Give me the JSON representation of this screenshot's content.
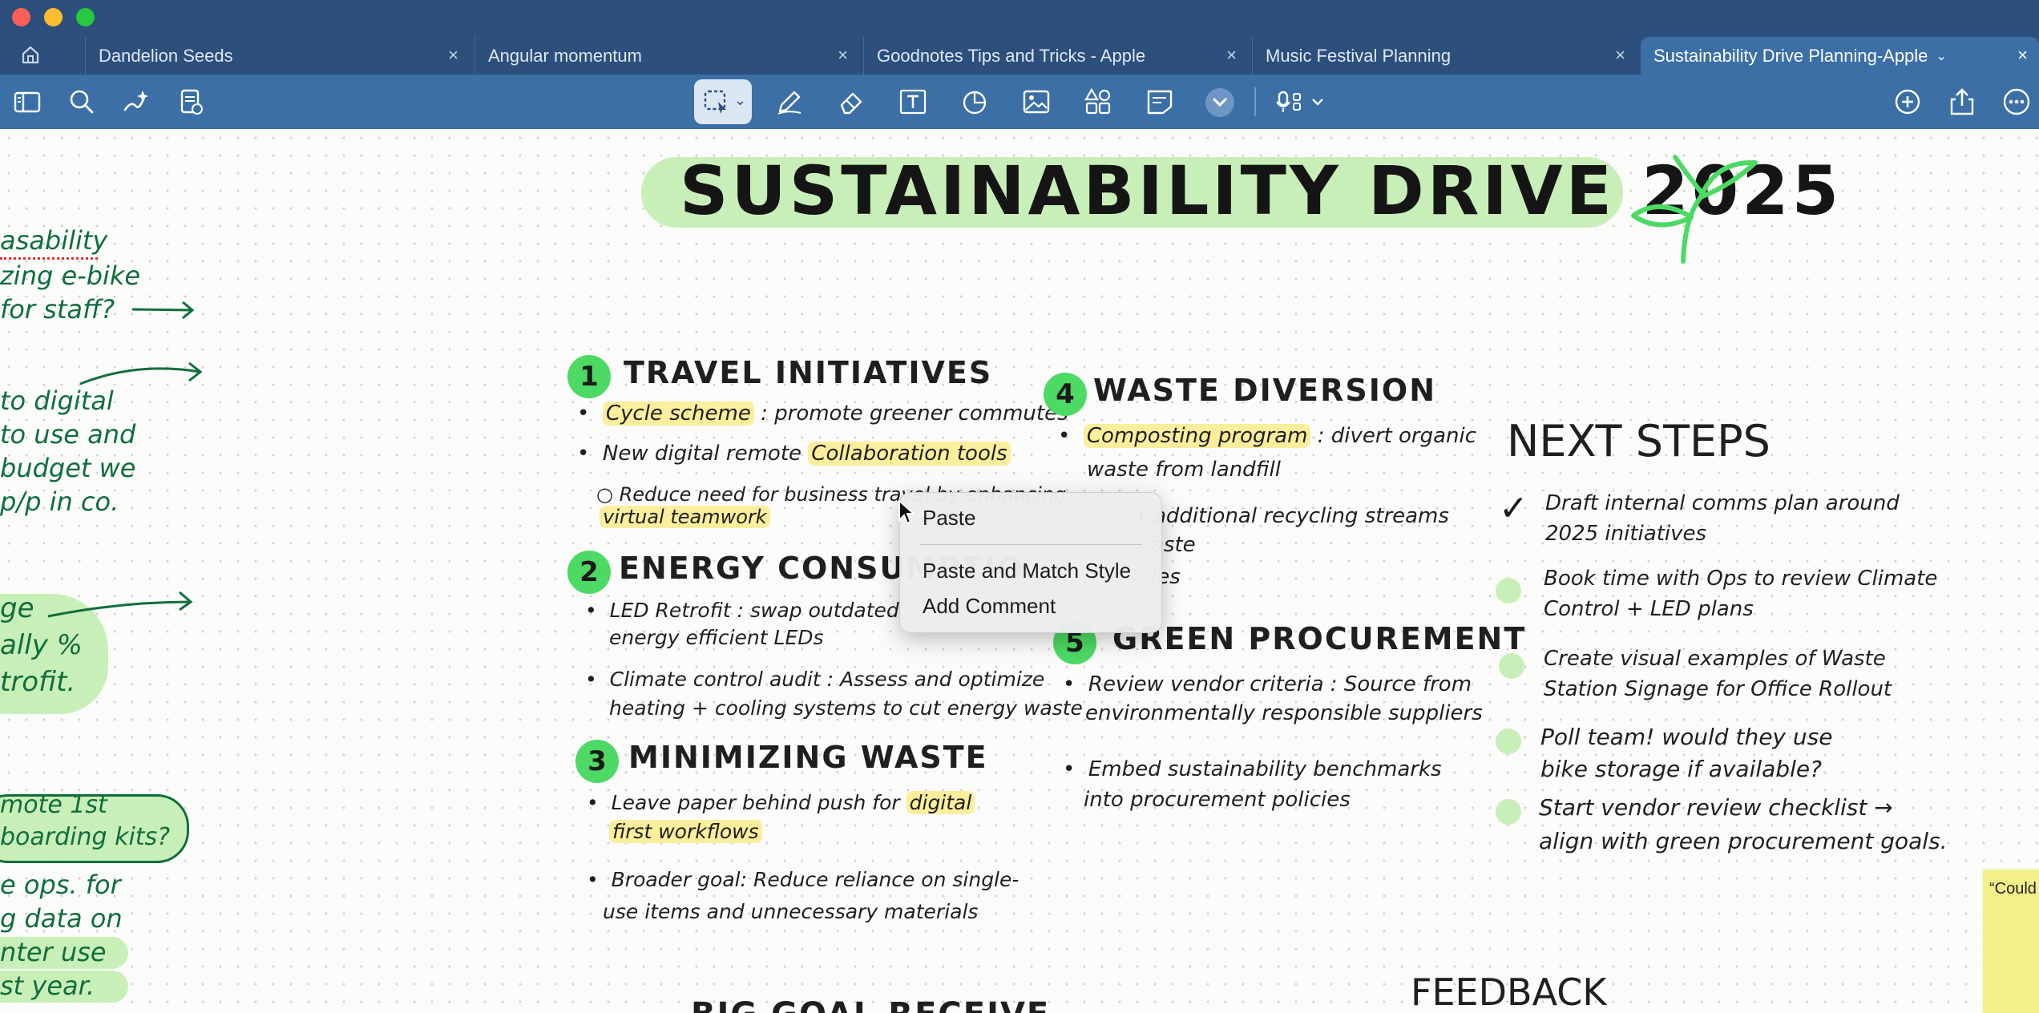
{
  "window": {
    "tabs": [
      {
        "label": "Dandelion Seeds",
        "close": "×"
      },
      {
        "label": "Angular momentum",
        "close": "×"
      },
      {
        "label": "Goodnotes Tips and Tricks - Apple",
        "close": "×"
      },
      {
        "label": "Music Festival Planning",
        "close": "×"
      },
      {
        "label": "Sustainability Drive Planning-Apple",
        "close": "×",
        "active": true
      }
    ]
  },
  "toolbar": {
    "left_icons": [
      "sidebar-icon",
      "search-icon",
      "ai-sparkle-icon",
      "document-icon"
    ],
    "center_icons": [
      "lasso-icon",
      "pen-icon",
      "eraser-icon",
      "text-box-icon",
      "shapes-icon",
      "image-icon",
      "elements-icon",
      "sticky-note-icon",
      "more-tools-icon",
      "audio-record-icon"
    ],
    "right_icons": [
      "add-icon",
      "share-icon",
      "more-icon"
    ]
  },
  "canvas": {
    "title": "SUSTAINABILITY DRIVE 2025",
    "left_margin_notes": [
      [
        "asability",
        "zing e-bike",
        "for staff?"
      ],
      [
        "to digital",
        "to use and",
        "budget we",
        "p/p in co."
      ],
      [
        "ge",
        "ally %",
        "trofit."
      ],
      [
        "mote 1st",
        "boarding kits?"
      ],
      [
        "e ops. for",
        "g data on",
        "nter use",
        "st year."
      ]
    ],
    "sections": [
      {
        "number": "1",
        "heading": "TRAVEL INITIATIVES",
        "bullets": [
          {
            "highlight": "Cycle scheme",
            "text": ": promote greener commutes"
          },
          {
            "pre": "New digital remote",
            "highlight": "Collaboration tools",
            "text": ""
          },
          {
            "sub": "Reduce need for business travel by enhancing",
            "highlight": "virtual teamwork"
          }
        ]
      },
      {
        "number": "2",
        "heading": "ENERGY CONSUMPTIO",
        "bullets": [
          {
            "line1": "LED Retrofit : swap outdated",
            "line2": "energy efficient LEDs"
          },
          {
            "line1": "Climate control audit : Assess and optimize",
            "line2": "heating + cooling systems to cut energy waste"
          }
        ]
      },
      {
        "number": "3",
        "heading": "MINIMIZING WASTE",
        "bullets": [
          {
            "line1": "Leave paper behind push for",
            "highlight": "digital",
            "line2_hl": "first workflows"
          },
          {
            "line1": "Broader goal: Reduce reliance on single-",
            "line2": "use items and unnecessary materials"
          }
        ]
      },
      {
        "number": "4",
        "heading": "WASTE DIVERSION",
        "bullets": [
          {
            "highlight": "Composting program",
            "text": ": divert organic",
            "line2": "waste from landfill"
          },
          {
            "line1": "r additional recycling streams",
            "line2": "aste"
          },
          {
            "line1": "ies"
          }
        ]
      },
      {
        "number": "5",
        "heading": "GREEN PROCUREMENT",
        "bullets": [
          {
            "line1": "Review vendor criteria : Source from",
            "line2": "environmentally responsible suppliers"
          },
          {
            "line1": "Embed sustainability benchmarks",
            "line2": "into procurement policies"
          }
        ]
      }
    ],
    "next_steps": {
      "heading": "NEXT STEPS",
      "check": "✓",
      "items": [
        {
          "line1": "Draft internal comms plan around",
          "line2": "2025 initiatives"
        },
        {
          "line1": "Book time with Ops to review Climate",
          "line2": "Control + LED plans"
        },
        {
          "line1": "Create visual examples of Waste",
          "line2": "Station Signage for Office Rollout"
        },
        {
          "line1": "Poll team! would they use",
          "line2": "bike storage if available?"
        },
        {
          "line1": "Start vendor review checklist →",
          "line2": "align with green procurement goals."
        }
      ]
    },
    "feedback_heading": "FEEDBACK",
    "bottom_partial_heading": "BIG GOAL RECEIVE",
    "sticky_note": "“Could comms internal"
  },
  "context_menu": {
    "items": [
      "Paste",
      "Paste and Match Style",
      "Add Comment"
    ]
  },
  "colors": {
    "titlebar": "#2c4f7c",
    "toolbar": "#3b6fa6",
    "accent_green": "#4cd964",
    "title_highlight": "#c9efb8",
    "text_highlight": "#fbee9c"
  }
}
